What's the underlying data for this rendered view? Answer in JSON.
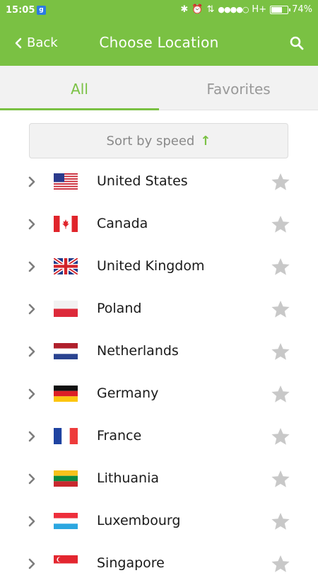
{
  "status_bar": {
    "time": "15:05",
    "notification_icon": "g",
    "network": "H+",
    "battery": "74%",
    "battery_level": 0.74
  },
  "app_bar": {
    "back_label": "Back",
    "title": "Choose Location"
  },
  "tabs": [
    {
      "label": "All",
      "active": true
    },
    {
      "label": "Favorites",
      "active": false
    }
  ],
  "sort_button": {
    "label": "Sort by speed",
    "arrow": "↑"
  },
  "locations": [
    {
      "name": "United States",
      "flag": "us"
    },
    {
      "name": "Canada",
      "flag": "ca"
    },
    {
      "name": "United Kingdom",
      "flag": "gb"
    },
    {
      "name": "Poland",
      "flag": "pl"
    },
    {
      "name": "Netherlands",
      "flag": "nl"
    },
    {
      "name": "Germany",
      "flag": "de"
    },
    {
      "name": "France",
      "flag": "fr"
    },
    {
      "name": "Lithuania",
      "flag": "lt"
    },
    {
      "name": "Luxembourg",
      "flag": "lu"
    },
    {
      "name": "Singapore",
      "flag": "sg"
    }
  ],
  "colors": {
    "accent": "#7ac143",
    "star_inactive": "#c8c8c8",
    "chevron": "#7d7d7d"
  }
}
